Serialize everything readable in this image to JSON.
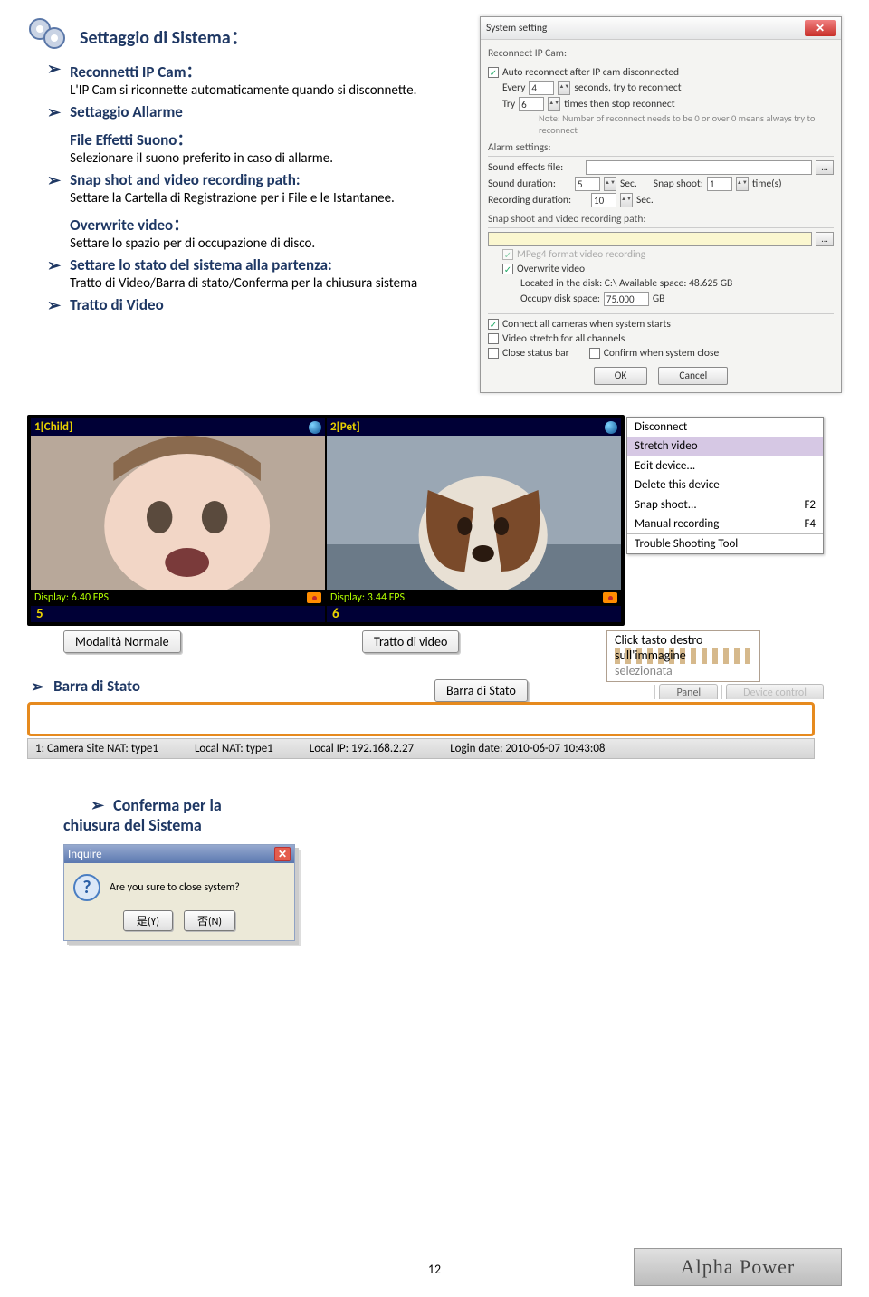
{
  "header": {
    "title": "Settaggio di Sistema："
  },
  "bullets": [
    {
      "title": "Reconnetti IP Cam：",
      "desc": "L'IP Cam si riconnette automaticamente quando si disconnette."
    },
    {
      "title": "Settaggio Allarme",
      "subtitle": "File Effetti Suono：",
      "desc": "Selezionare il suono preferito in caso di allarme."
    },
    {
      "title": "Snap shot and video recording path:",
      "desc": "Settare la Cartella di Registrazione per i File e le Istantanee.",
      "subtitle2": "Overwrite video：",
      "desc2": "Settare lo spazio per di occupazione di disco."
    },
    {
      "title": "Settare lo stato del sistema alla partenza:",
      "desc": "Tratto di Video/Barra di stato/Conferma per la chiusura sistema"
    },
    {
      "title": "Tratto di Video"
    }
  ],
  "dialog": {
    "title": "System setting",
    "grp1": "Reconnect IP Cam:",
    "auto": "Auto reconnect after IP cam disconnected",
    "everyL": "Every",
    "everyV": "4",
    "everyR": "seconds, try to reconnect",
    "tryL": "Try",
    "tryV": "6",
    "tryR": "times then stop reconnect",
    "note": "Note: Number of reconnect needs to be 0 or over 0 means always try to reconnect",
    "grp2": "Alarm settings:",
    "sef": "Sound effects file:",
    "sdL": "Sound duration:",
    "sdV": "5",
    "sdU": "Sec.",
    "ssL": "Snap shoot:",
    "ssV": "1",
    "ssU": "time(s)",
    "rdL": "Recording duration:",
    "rdV": "10",
    "rdU": "Sec.",
    "grp3": "Snap shoot and video recording path:",
    "mpeg": "MPeg4 format video recording",
    "ovw": "Overwrite video",
    "locL": "Located in the disk: C:\\  Available space: 48.625 GB",
    "occL": "Occupy disk space:",
    "occV": "75.000",
    "occU": "GB",
    "c1": "Connect all cameras when system starts",
    "c2": "Video stretch for all channels",
    "c3": "Close status bar",
    "c4": "Confirm when system close",
    "ok": "OK",
    "cancel": "Cancel"
  },
  "video": {
    "h1": "1[Child]",
    "h2": "2[Pet]",
    "f1": "Display: 6.40 FPS",
    "f2": "Display: 3.44 FPS",
    "n5": "5",
    "n6": "6"
  },
  "ctx": {
    "disconnect": "Disconnect",
    "stretch": "Stretch video",
    "edit": "Edit device...",
    "delete": "Delete this device",
    "snap": "Snap shoot...",
    "snapK": "F2",
    "man": "Manual recording",
    "manK": "F4",
    "trouble": "Trouble Shooting Tool"
  },
  "tags": {
    "normal": "Modalità Normale",
    "tratto": "Tratto di video",
    "barra": "Barra di Stato",
    "click1": "Click tasto destro",
    "click2": "sull'immagine",
    "click3": "selezionata"
  },
  "barraTitle": "Barra di Stato",
  "panel": {
    "p": "Panel",
    "d": "Device control"
  },
  "status": {
    "a": "1: Camera Site NAT: type1",
    "b": "Local NAT: type1",
    "c": "Local IP: 192.168.2.27",
    "d": "Login date: 2010-06-07 10:43:08"
  },
  "inquire": {
    "h1": "Conferma per la",
    "h2": "chiusura del Sistema",
    "t": "Inquire",
    "msg": "Are you sure to close system?",
    "yes": "是(Y)",
    "no": "否(N)"
  },
  "pageNum": "12",
  "logo": "Alpha Power"
}
